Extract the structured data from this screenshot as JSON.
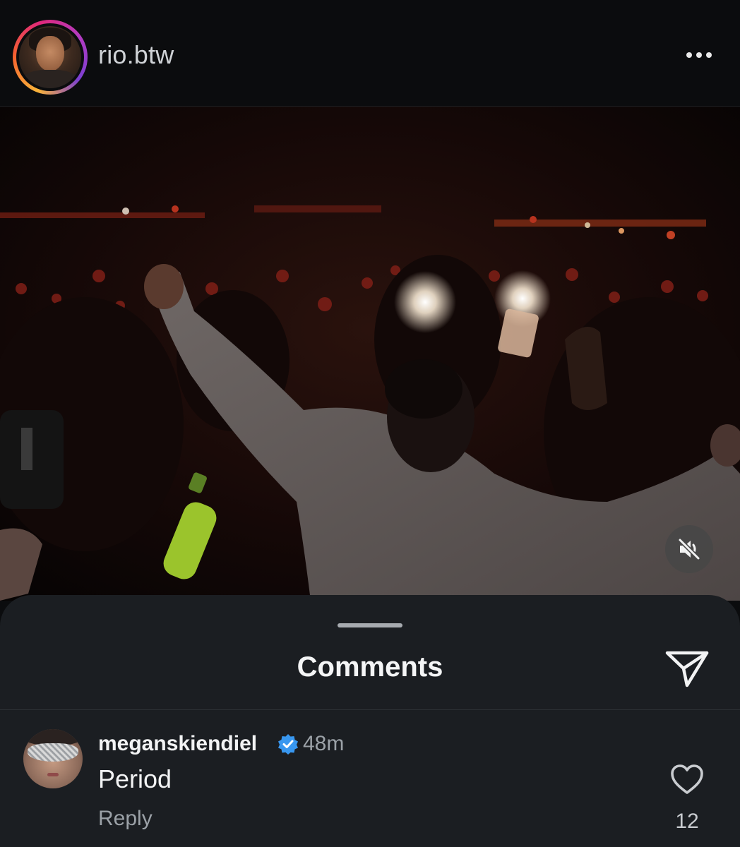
{
  "post": {
    "username": "rio.btw",
    "more_icon": "ellipsis-horizontal-icon",
    "avatar_icon": "profile-photo",
    "media": {
      "mute_icon": "speaker-muted-icon",
      "muted": true
    }
  },
  "comments_sheet": {
    "title": "Comments",
    "share_icon": "paper-plane-icon",
    "comments": [
      {
        "username": "meganskiendiel",
        "verified": true,
        "time": "48m",
        "text": "Period",
        "reply_label": "Reply",
        "like_icon": "heart-outline-icon",
        "like_count": "12"
      }
    ]
  },
  "colors": {
    "background": "#0b0c0e",
    "sheet": "#1b1e22",
    "verified": "#3897f0",
    "muted_text": "#9ba1a7"
  }
}
